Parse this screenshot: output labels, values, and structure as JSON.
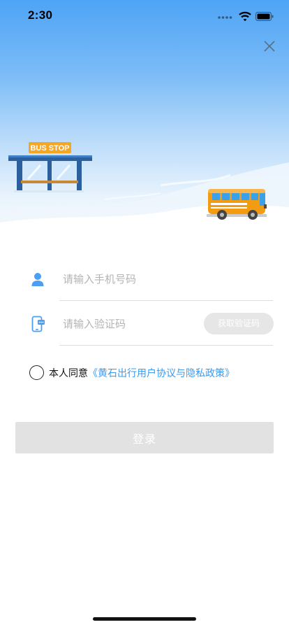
{
  "status_bar": {
    "time": "2:30"
  },
  "hero": {
    "bus_stop_sign": "BUS STOP"
  },
  "form": {
    "phone_placeholder": "请输入手机号码",
    "code_placeholder": "请输入验证码",
    "get_code_label": "获取验证码"
  },
  "agreement": {
    "prefix": "本人同意",
    "link": "《黄石出行用户协议与隐私政策》",
    "checked": false
  },
  "login_label": "登录",
  "colors": {
    "accent": "#3a9af0",
    "icon": "#4b9ff2",
    "bus_body": "#f39c12",
    "sign": "#f5a623",
    "disabled_button": "#e2e2e2"
  },
  "icons": {
    "close": "close-icon",
    "phone_field": "user-icon",
    "code_field": "phone-sms-icon"
  }
}
